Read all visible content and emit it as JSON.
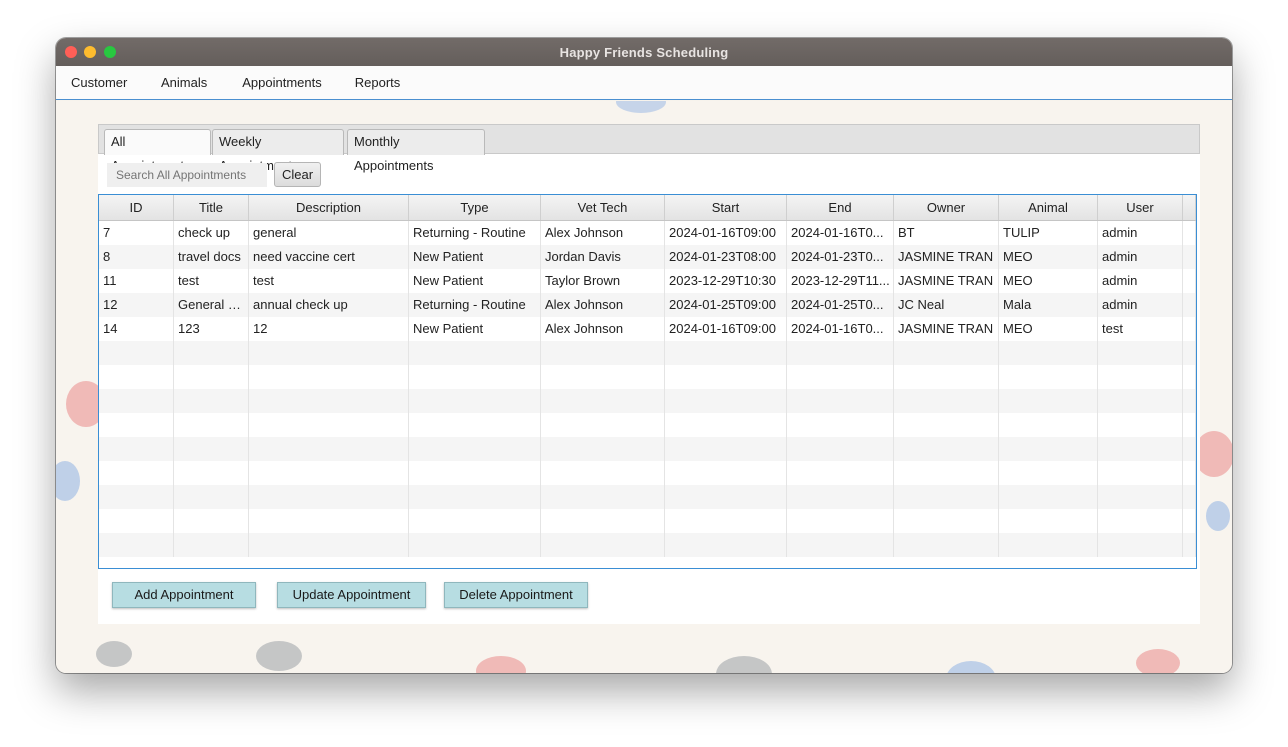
{
  "window": {
    "title": "Happy Friends Scheduling"
  },
  "menu": [
    "Customer",
    "Animals",
    "Appointments",
    "Reports"
  ],
  "tabs": [
    "All Appointments",
    "Weekly Appointments",
    "Monthly Appointments"
  ],
  "search": {
    "placeholder": "Search All Appointments"
  },
  "clear_label": "Clear",
  "table": {
    "columns": [
      "ID",
      "Title",
      "Description",
      "Type",
      "Vet Tech",
      "Start",
      "End",
      "Owner",
      "Animal",
      "User"
    ],
    "rows": [
      [
        "7",
        "check up",
        "general",
        "Returning - Routine",
        "Alex Johnson",
        "2024-01-16T09:00",
        "2024-01-16T0...",
        "BT",
        "TULIP",
        "admin"
      ],
      [
        "8",
        "travel docs",
        "need vaccine cert",
        "New Patient",
        "Jordan Davis",
        "2024-01-23T08:00",
        "2024-01-23T0...",
        "JASMINE TRAN",
        "MEO",
        "admin"
      ],
      [
        "11",
        "test",
        "test",
        "New Patient",
        "Taylor Brown",
        "2023-12-29T10:30",
        "2023-12-29T11...",
        "JASMINE TRAN",
        "MEO",
        "admin"
      ],
      [
        "12",
        "General C...",
        "annual check up",
        "Returning - Routine",
        "Alex Johnson",
        "2024-01-25T09:00",
        "2024-01-25T0...",
        "JC Neal",
        "Mala",
        "admin"
      ],
      [
        "14",
        "123",
        "12",
        "New Patient",
        "Alex Johnson",
        "2024-01-16T09:00",
        "2024-01-16T0...",
        "JASMINE TRAN",
        "MEO",
        "test"
      ]
    ]
  },
  "buttons": {
    "add": "Add Appointment",
    "update": "Update Appointment",
    "delete": "Delete Appointment"
  }
}
